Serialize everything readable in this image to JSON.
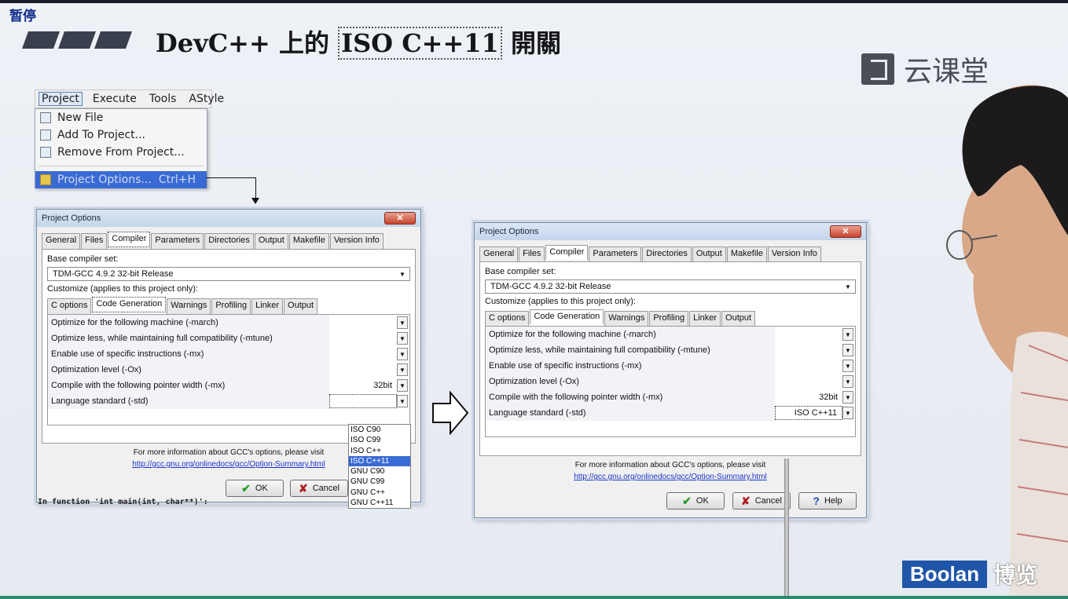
{
  "overlay": {
    "pause": "暂停"
  },
  "slide": {
    "title_before": "DevC++ 上的",
    "title_boxed": "ISO C++11",
    "title_after": "開關",
    "brand_cloud": "云课堂",
    "brand_boolan": "Boolan",
    "brand_boolan_cn": "博览"
  },
  "menu": {
    "bar": [
      "Project",
      "Execute",
      "Tools",
      "AStyle"
    ],
    "items": [
      "New File",
      "Add To Project...",
      "Remove From Project..."
    ],
    "highlight_label": "Project Options...",
    "highlight_shortcut": "Ctrl+H"
  },
  "dialog_left": {
    "title": "Project Options",
    "tabs": [
      "General",
      "Files",
      "Compiler",
      "Parameters",
      "Directories",
      "Output",
      "Makefile",
      "Version Info"
    ],
    "base_label": "Base compiler set:",
    "base_value": "TDM-GCC 4.9.2 32-bit Release",
    "customize": "Customize (applies to this project only):",
    "subtabs": [
      "C options",
      "Code Generation",
      "Warnings",
      "Profiling",
      "Linker",
      "Output"
    ],
    "options": [
      {
        "label": "Optimize for the following machine (-march)",
        "value": ""
      },
      {
        "label": "Optimize less, while maintaining full compatibility (-mtune)",
        "value": ""
      },
      {
        "label": "Enable use of specific instructions (-mx)",
        "value": ""
      },
      {
        "label": "Optimization level (-Ox)",
        "value": ""
      },
      {
        "label": "Compile with the following pointer width (-mx)",
        "value": "32bit"
      },
      {
        "label": "Language standard (-std)",
        "value": ""
      }
    ],
    "info": "For more information about GCC's options, please visit",
    "link": "http://gcc.gnu.org/onlinedocs/gcc/Option-Summary.html",
    "ok": "OK",
    "cancel": "Cancel",
    "std_options": [
      "ISO C90",
      "ISO C99",
      "ISO C++",
      "ISO C++11",
      "GNU C90",
      "GNU C99",
      "GNU C++",
      "GNU C++11"
    ],
    "std_selected_index": 3
  },
  "dialog_right": {
    "title": "Project Options",
    "tabs": [
      "General",
      "Files",
      "Compiler",
      "Parameters",
      "Directories",
      "Output",
      "Makefile",
      "Version Info"
    ],
    "base_label": "Base compiler set:",
    "base_value": "TDM-GCC 4.9.2 32-bit Release",
    "customize": "Customize (applies to this project only):",
    "subtabs": [
      "C options",
      "Code Generation",
      "Warnings",
      "Profiling",
      "Linker",
      "Output"
    ],
    "options": [
      {
        "label": "Optimize for the following machine (-march)",
        "value": ""
      },
      {
        "label": "Optimize less, while maintaining full compatibility (-mtune)",
        "value": ""
      },
      {
        "label": "Enable use of specific instructions (-mx)",
        "value": ""
      },
      {
        "label": "Optimization level (-Ox)",
        "value": ""
      },
      {
        "label": "Compile with the following pointer width (-mx)",
        "value": "32bit"
      },
      {
        "label": "Language standard (-std)",
        "value": "ISO C++11"
      }
    ],
    "info": "For more information about GCC's options, please visit",
    "link": "http://gcc.gnu.org/onlinedocs/gcc/Option-Summary.html",
    "ok": "OK",
    "cancel": "Cancel",
    "help": "Help"
  },
  "background_code": "In function 'int main(int, char**)':",
  "colors": {
    "highlight": "#3a6bd4",
    "boolan_blue": "#1f56a8"
  }
}
